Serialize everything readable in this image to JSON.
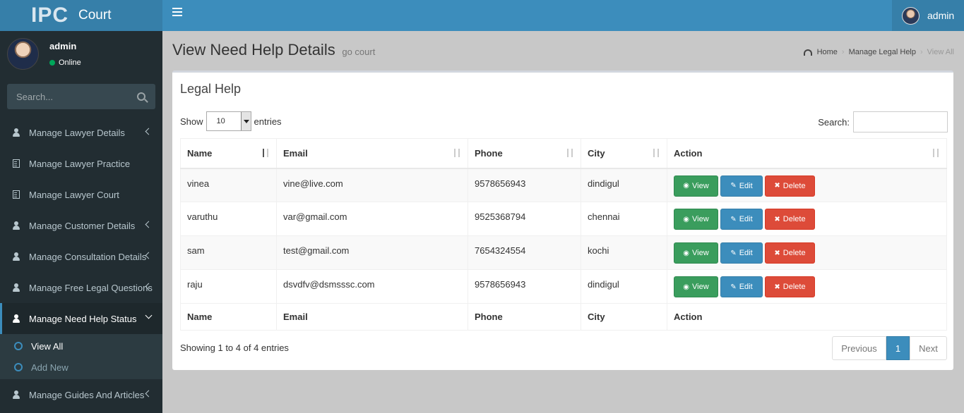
{
  "brand": {
    "short": "IPC",
    "name": "Court"
  },
  "topbar": {
    "user_name": "admin"
  },
  "sidebar": {
    "user_name": "admin",
    "user_status": "Online",
    "search_placeholder": "Search...",
    "items": [
      {
        "label": "Manage Lawyer Details",
        "icon": "user-icon",
        "chevron": true
      },
      {
        "label": "Manage Lawyer Practice",
        "icon": "building-icon",
        "chevron": false
      },
      {
        "label": "Manage Lawyer Court",
        "icon": "building-icon",
        "chevron": false
      },
      {
        "label": "Manage Customer Details",
        "icon": "user-icon",
        "chevron": true
      },
      {
        "label": "Manage Consultation Details",
        "icon": "user-icon",
        "chevron": true
      },
      {
        "label": "Manage Free Legal Questions",
        "icon": "user-icon",
        "chevron": true
      },
      {
        "label": "Manage Need Help Status",
        "icon": "user-icon",
        "chevron": true,
        "active": true
      },
      {
        "label": "Manage Guides And Articles",
        "icon": "user-icon",
        "chevron": true
      }
    ],
    "submenu": [
      {
        "label": "View All"
      },
      {
        "label": "Add New"
      }
    ]
  },
  "header": {
    "title": "View Need Help Details",
    "subtitle": "go court",
    "breadcrumb": [
      "Home",
      "Manage Legal Help",
      "View All"
    ]
  },
  "box": {
    "title": "Legal Help",
    "show_label": "Show",
    "entries_label": "entries",
    "page_size": "10",
    "search_label": "Search:"
  },
  "table": {
    "columns": [
      "Name",
      "Email",
      "Phone",
      "City",
      "Action"
    ],
    "rows": [
      {
        "name": "vinea",
        "email": "vine@live.com",
        "phone": "9578656943",
        "city": "dindigul"
      },
      {
        "name": "varuthu",
        "email": "var@gmail.com",
        "phone": "9525368794",
        "city": "chennai"
      },
      {
        "name": "sam",
        "email": "test@gmail.com",
        "phone": "7654324554",
        "city": "kochi"
      },
      {
        "name": "raju",
        "email": "dsvdfv@dsmsssc.com",
        "phone": "9578656943",
        "city": "dindigul"
      }
    ],
    "actions": {
      "view": "View",
      "edit": "Edit",
      "delete": "Delete"
    }
  },
  "footer": {
    "info": "Showing 1 to 4 of 4 entries",
    "previous": "Previous",
    "page": "1",
    "next": "Next"
  }
}
